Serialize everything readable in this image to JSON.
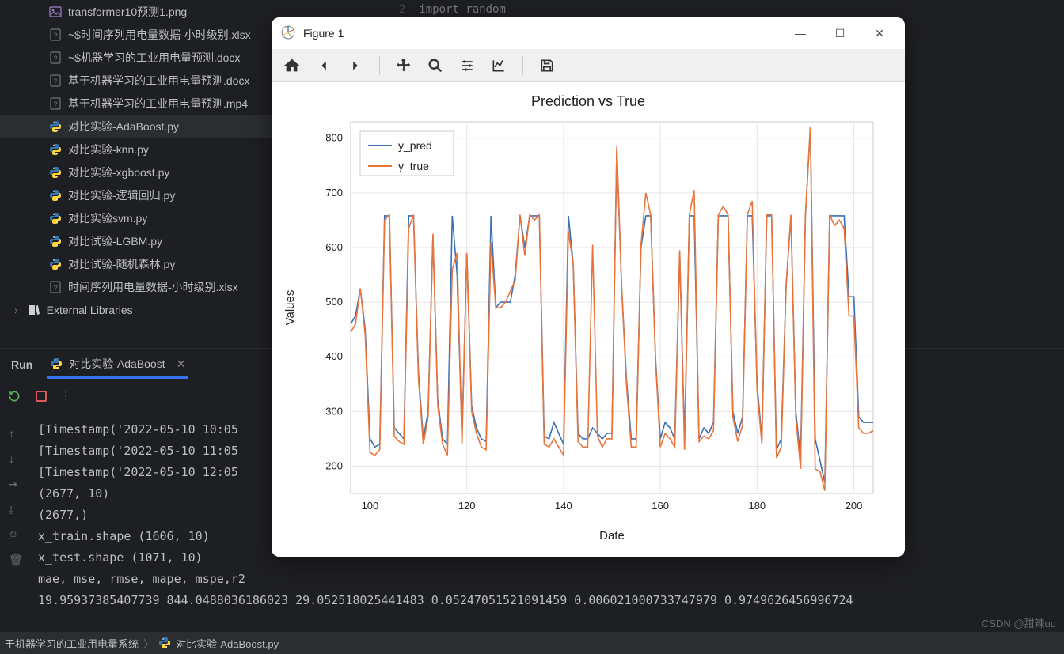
{
  "editor_hint": {
    "line_num": "2",
    "code": "import random"
  },
  "files": [
    {
      "name": "transformer10预测1.png",
      "icon": "img"
    },
    {
      "name": "~$时间序列用电量数据-小时级别.xlsx",
      "icon": "unk"
    },
    {
      "name": "~$机器学习的工业用电量预测.docx",
      "icon": "unk"
    },
    {
      "name": "基于机器学习的工业用电量预测.docx",
      "icon": "unk"
    },
    {
      "name": "基于机器学习的工业用电量预测.mp4",
      "icon": "unk"
    },
    {
      "name": "对比实验-AdaBoost.py",
      "icon": "py",
      "selected": true
    },
    {
      "name": "对比实验-knn.py",
      "icon": "py"
    },
    {
      "name": "对比实验-xgboost.py",
      "icon": "py"
    },
    {
      "name": "对比实验-逻辑回归.py",
      "icon": "py"
    },
    {
      "name": "对比实验svm.py",
      "icon": "py"
    },
    {
      "name": "对比试验-LGBM.py",
      "icon": "py"
    },
    {
      "name": "对比试验-随机森林.py",
      "icon": "py"
    },
    {
      "name": "时间序列用电量数据-小时级别.xlsx",
      "icon": "unk"
    }
  ],
  "ext_lib": "External Libraries",
  "run": {
    "label": "Run",
    "tab": "对比实验-AdaBoost"
  },
  "console_lines": [
    "[Timestamp('2022-05-10 10:05",
    "[Timestamp('2022-05-10 11:05",
    "[Timestamp('2022-05-10 12:05",
    "(2677, 10)",
    "(2677,)",
    "x_train.shape (1606, 10)",
    "x_test.shape (1071, 10)",
    "mae, mse, rmse, mape, mspe,r2",
    "19.95937385407739 844.0488036186023 29.052518025441483 0.05247051521091459 0.006021000733747979 0.9749626456996724"
  ],
  "breadcrumb": {
    "a": "于机器学习的工业用电量系统",
    "b": "对比实验-AdaBoost.py"
  },
  "watermark": "CSDN @甜辣uu",
  "figure": {
    "window_title": "Figure 1",
    "title": "Prediction vs True",
    "xlabel": "Date",
    "ylabel": "Values",
    "legend": [
      "y_pred",
      "y_true"
    ],
    "xticks": [
      100,
      120,
      140,
      160,
      180,
      200
    ],
    "yticks": [
      200,
      300,
      400,
      500,
      600,
      700,
      800
    ]
  },
  "chart_data": {
    "type": "line",
    "title": "Prediction vs True",
    "xlabel": "Date",
    "ylabel": "Values",
    "xlim": [
      96,
      204
    ],
    "ylim": [
      150,
      830
    ],
    "x": [
      96,
      97,
      98,
      99,
      100,
      101,
      102,
      103,
      104,
      105,
      106,
      107,
      108,
      109,
      110,
      111,
      112,
      113,
      114,
      115,
      116,
      117,
      118,
      119,
      120,
      121,
      122,
      123,
      124,
      125,
      126,
      127,
      128,
      129,
      130,
      131,
      132,
      133,
      134,
      135,
      136,
      137,
      138,
      139,
      140,
      141,
      142,
      143,
      144,
      145,
      146,
      147,
      148,
      149,
      150,
      151,
      152,
      153,
      154,
      155,
      156,
      157,
      158,
      159,
      160,
      161,
      162,
      163,
      164,
      165,
      166,
      167,
      168,
      169,
      170,
      171,
      172,
      173,
      174,
      175,
      176,
      177,
      178,
      179,
      180,
      181,
      182,
      183,
      184,
      185,
      186,
      187,
      188,
      189,
      190,
      191,
      192,
      193,
      194,
      195,
      196,
      197,
      198,
      199,
      200,
      201,
      202,
      203,
      204
    ],
    "series": [
      {
        "name": "y_pred",
        "color": "#3b6fb6",
        "values": [
          460,
          475,
          525,
          450,
          250,
          235,
          240,
          658,
          658,
          270,
          260,
          250,
          658,
          658,
          370,
          250,
          300,
          620,
          320,
          250,
          240,
          658,
          550,
          255,
          590,
          310,
          270,
          250,
          245,
          658,
          490,
          500,
          500,
          500,
          550,
          658,
          600,
          658,
          658,
          658,
          255,
          250,
          280,
          260,
          240,
          658,
          570,
          260,
          250,
          250,
          270,
          260,
          250,
          260,
          260,
          780,
          530,
          360,
          250,
          250,
          600,
          658,
          658,
          400,
          250,
          280,
          270,
          250,
          590,
          250,
          658,
          658,
          250,
          270,
          260,
          280,
          658,
          658,
          658,
          300,
          260,
          290,
          658,
          658,
          350,
          250,
          658,
          658,
          230,
          250,
          530,
          658,
          300,
          215,
          658,
          820,
          250,
          210,
          170,
          658,
          658,
          658,
          658,
          510,
          510,
          290,
          280,
          280,
          280
        ]
      },
      {
        "name": "y_true",
        "color": "#e8743b",
        "values": [
          445,
          460,
          525,
          440,
          225,
          220,
          230,
          650,
          660,
          255,
          245,
          240,
          635,
          660,
          360,
          240,
          290,
          625,
          310,
          240,
          220,
          560,
          590,
          240,
          590,
          300,
          260,
          235,
          230,
          610,
          490,
          490,
          500,
          520,
          540,
          660,
          585,
          660,
          650,
          660,
          240,
          235,
          250,
          235,
          220,
          630,
          570,
          245,
          235,
          235,
          605,
          255,
          235,
          250,
          250,
          785,
          530,
          350,
          235,
          235,
          605,
          700,
          660,
          395,
          235,
          260,
          250,
          235,
          595,
          230,
          660,
          705,
          245,
          255,
          250,
          265,
          660,
          675,
          660,
          290,
          245,
          275,
          660,
          685,
          340,
          240,
          660,
          660,
          215,
          235,
          530,
          660,
          290,
          195,
          660,
          820,
          195,
          190,
          155,
          660,
          640,
          650,
          635,
          475,
          475,
          270,
          260,
          260,
          265
        ]
      }
    ]
  }
}
